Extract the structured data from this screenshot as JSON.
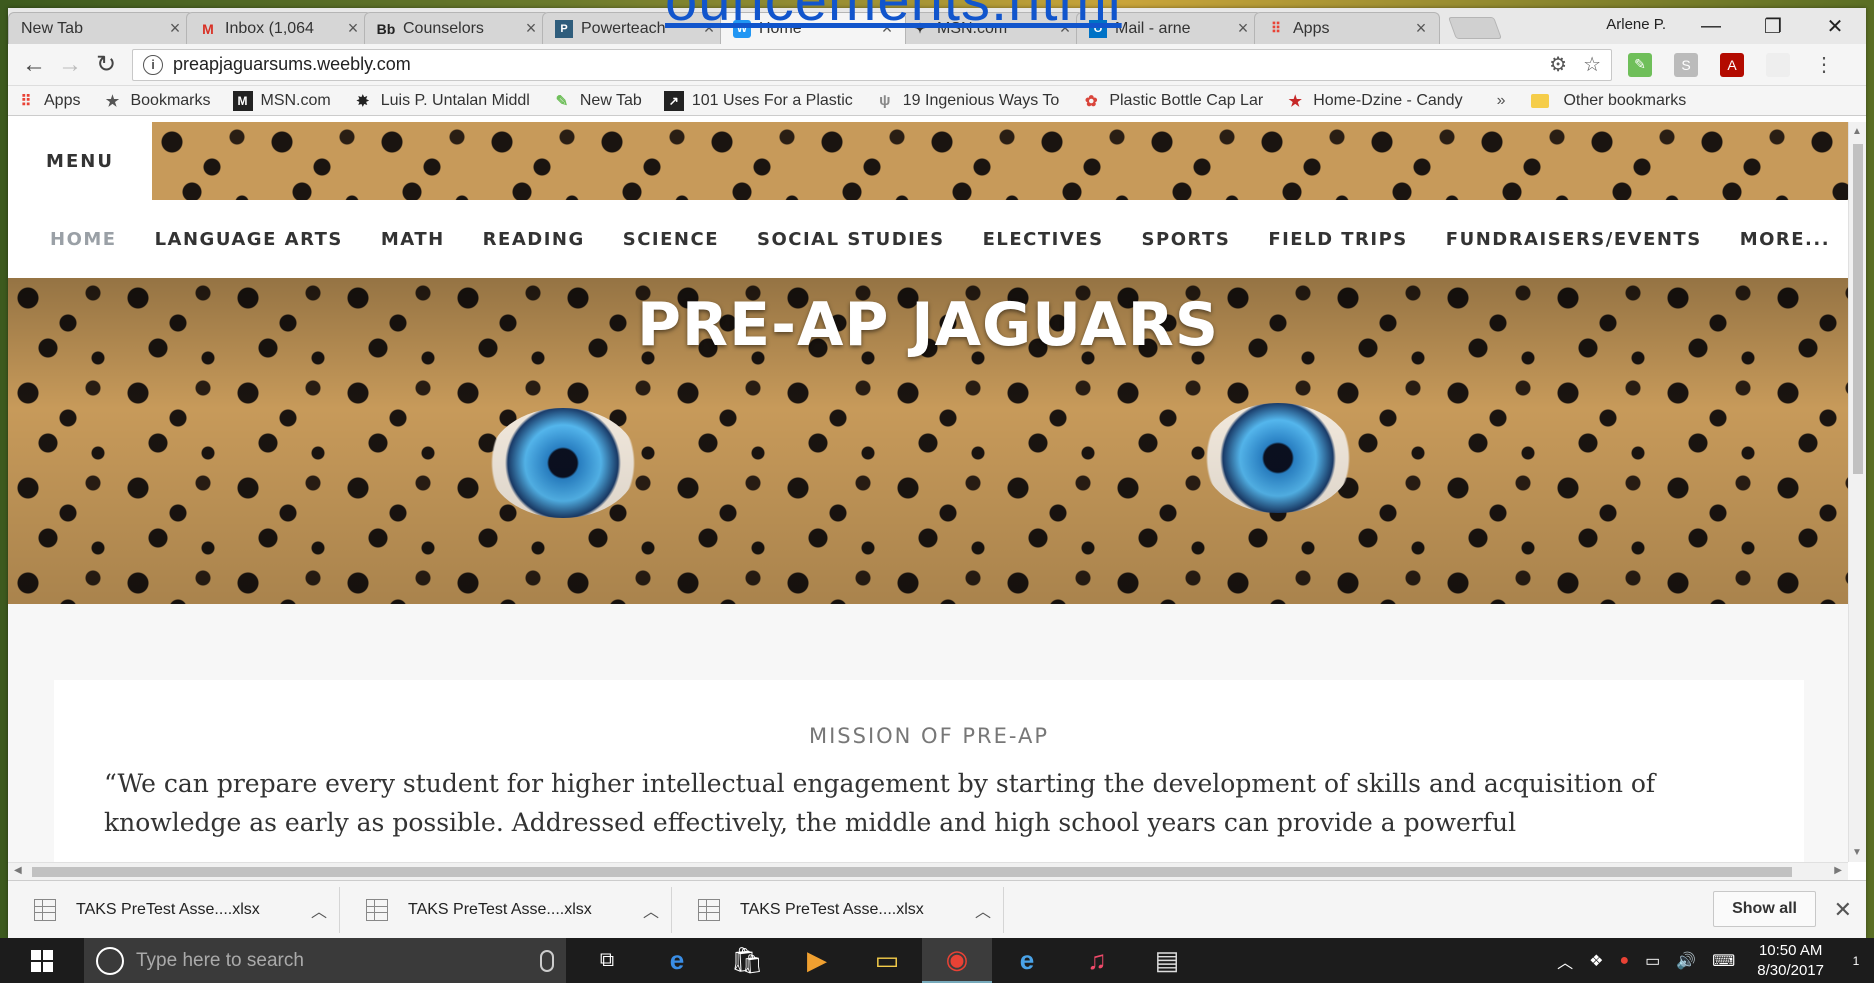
{
  "overlay": {
    "link_text": "ouncements.html"
  },
  "browser": {
    "tabs": [
      {
        "label": "New Tab",
        "icon": "blank-icon",
        "active": false
      },
      {
        "label": "Inbox (1,064",
        "icon": "gmail-icon",
        "active": false
      },
      {
        "label": "Counselors",
        "icon": "blackboard-icon",
        "active": false
      },
      {
        "label": "Powerteach",
        "icon": "powerteacher-icon",
        "active": false
      },
      {
        "label": "Home",
        "icon": "weebly-icon",
        "active": true
      },
      {
        "label": "MSN.com",
        "icon": "msn-icon",
        "active": false
      },
      {
        "label": "Mail - arne",
        "icon": "outlook-icon",
        "active": false
      },
      {
        "label": "Apps",
        "icon": "apps-grid-icon",
        "active": false
      }
    ],
    "profile_name": "Arlene P.",
    "window_controls": {
      "minimize": "—",
      "restore": "❐",
      "close": "✕"
    },
    "url": "preapjaguarsums.weebly.com",
    "bookmarks": [
      {
        "label": "Apps",
        "icon": "apps-grid-icon"
      },
      {
        "label": "Bookmarks",
        "icon": "star-icon"
      },
      {
        "label": "MSN.com",
        "icon": "msn-icon"
      },
      {
        "label": "Luis P. Untalan Middl",
        "icon": "school-icon"
      },
      {
        "label": "New Tab",
        "icon": "newtab-icon"
      },
      {
        "label": "101 Uses For a Plastic",
        "icon": "link-icon"
      },
      {
        "label": "19 Ingenious Ways To",
        "icon": "fork-icon"
      },
      {
        "label": "Plastic Bottle Cap Lar",
        "icon": "flower-icon"
      },
      {
        "label": "Home-Dzine - Candy",
        "icon": "red-star-icon"
      }
    ],
    "bookmarks_more": "»",
    "other_bookmarks": "Other bookmarks"
  },
  "site": {
    "menu_label": "MENU",
    "nav": [
      "HOME",
      "LANGUAGE ARTS",
      "MATH",
      "READING",
      "SCIENCE",
      "SOCIAL STUDIES",
      "ELECTIVES",
      "SPORTS",
      "FIELD TRIPS",
      "FUNDRAISERS/EVENTS",
      "MORE..."
    ],
    "hero_title": "PRE-AP JAGUARS",
    "mission_title": "MISSION OF PRE-AP",
    "mission_text": "“We can prepare every student for higher intellectual engagement by starting the development of skills and acquisition of knowledge as early as possible. Addressed effectively, the middle and high school years can provide a powerful"
  },
  "downloads": {
    "items": [
      "TAKS  PreTest Asse....xlsx",
      "TAKS  PreTest Asse....xlsx",
      "TAKS  PreTest Asse....xlsx"
    ],
    "show_all": "Show all"
  },
  "taskbar": {
    "search_placeholder": "Type here to search",
    "time": "10:50 AM",
    "date": "8/30/2017",
    "notifications": "1"
  }
}
